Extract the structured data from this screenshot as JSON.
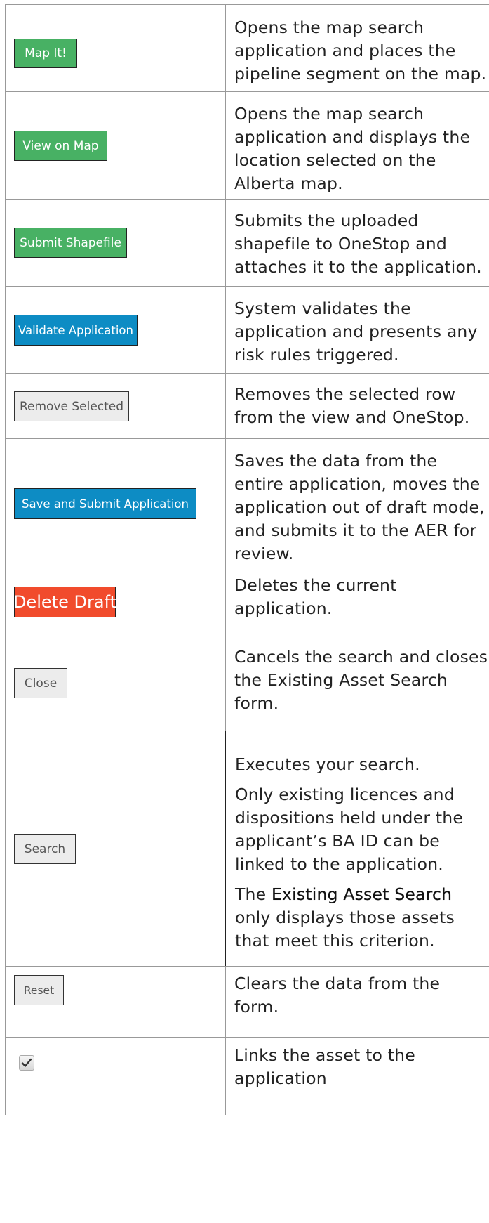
{
  "rows": [
    {
      "button": "Map It!",
      "desc": [
        "Opens the map search application and places the pipeline segment on the map."
      ]
    },
    {
      "button": "View on Map",
      "desc": [
        "Opens the map search application and displays the location selected on the Alberta map."
      ]
    },
    {
      "button": "Submit Shapefile",
      "desc": [
        "Submits the uploaded shapefile to OneStop and attaches it to the application."
      ]
    },
    {
      "button": "Validate Application",
      "desc": [
        "System validates the application and presents any risk rules triggered."
      ]
    },
    {
      "button": "Remove Selected",
      "desc": [
        "Removes the selected row from the view and OneStop."
      ]
    },
    {
      "button": "Save and Submit Application",
      "desc": [
        "Saves the data from the entire application, moves the application out of draft mode, and submits it to the AER for review."
      ]
    },
    {
      "button": "Delete Draft",
      "desc": [
        "Deletes the current application."
      ]
    },
    {
      "button": "Close",
      "desc": [
        "Cancels the search and closes the Existing Asset Search form."
      ]
    },
    {
      "button": "Search",
      "desc": [
        "Executes your search.",
        "Only existing licences and dispositions held under the applicant’s BA ID can be linked to the application."
      ],
      "desc_b_pre": "The ",
      "desc_b_bold": "Existing Asset Search",
      "desc_b_post": " only displays those assets that meet this criterion."
    },
    {
      "button": "Reset",
      "desc": [
        "Clears the data from the form."
      ]
    },
    {
      "button": "",
      "icon": "checkmark-icon",
      "desc": [
        "Links the asset to the application"
      ]
    }
  ]
}
